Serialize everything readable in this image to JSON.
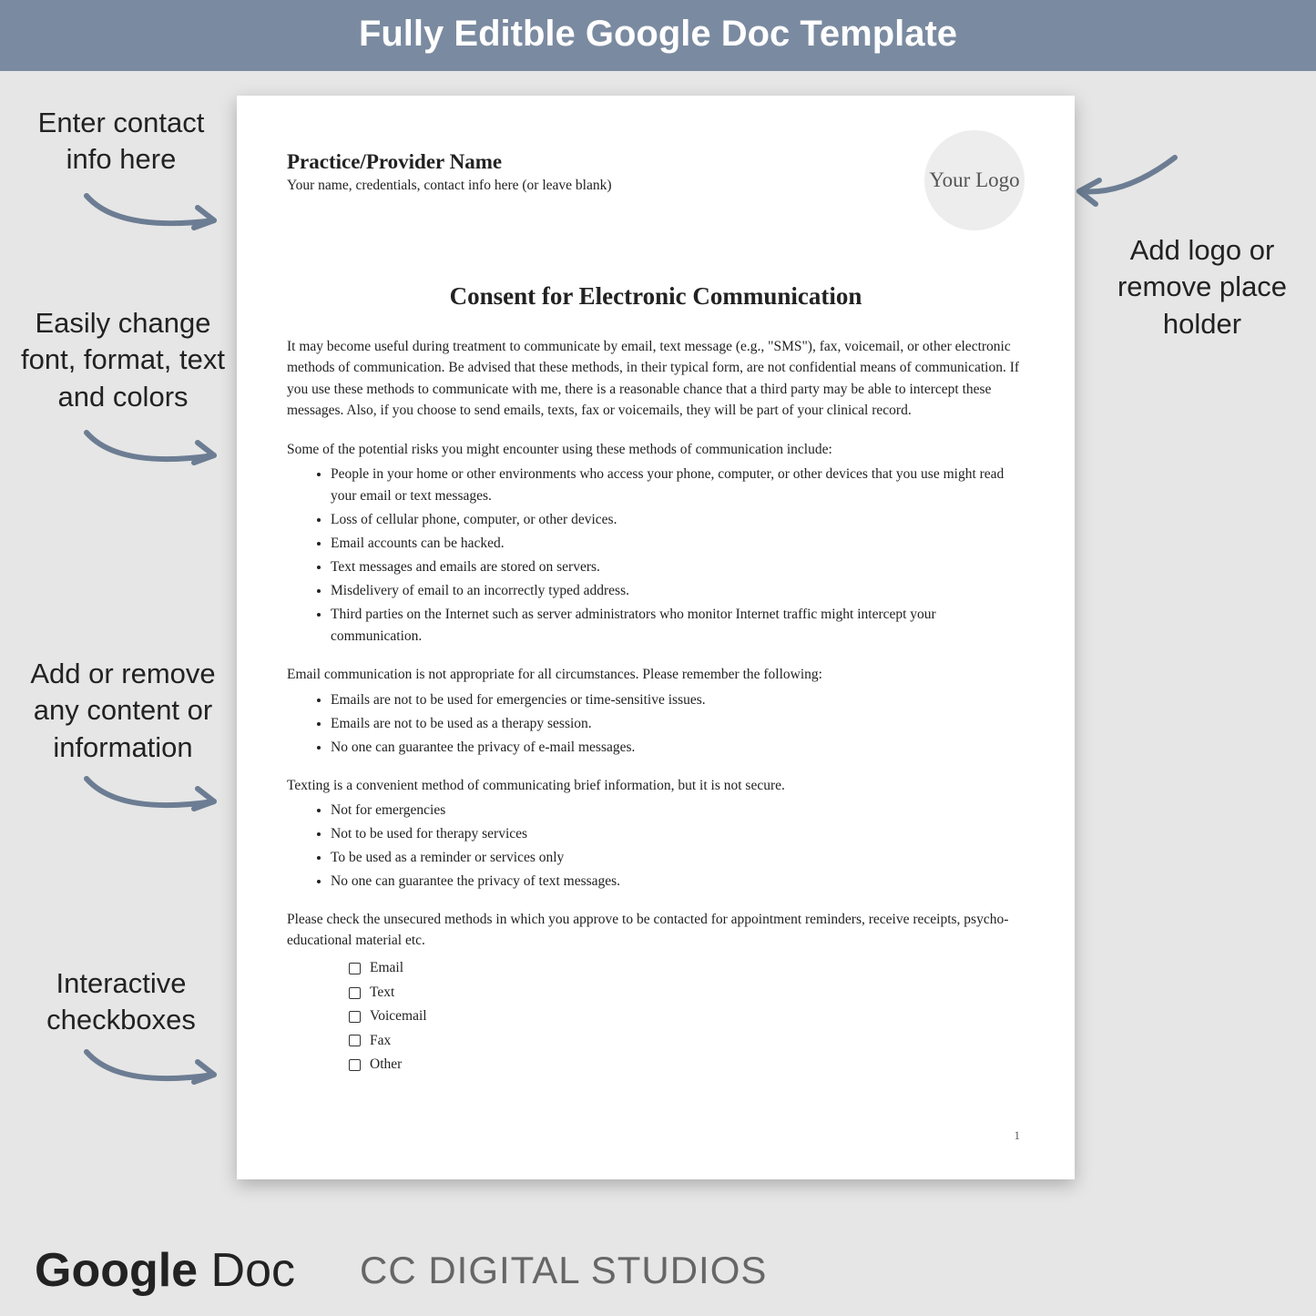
{
  "header": {
    "title": "Fully Editble Google Doc Template"
  },
  "callouts": {
    "contact": "Enter contact info here",
    "font": "Easily change font, format, text and colors",
    "content": "Add or remove any content or information",
    "checkboxes": "Interactive checkboxes",
    "logo": "Add logo or remove place holder"
  },
  "doc": {
    "practice_name": "Practice/Provider Name",
    "practice_sub": "Your name, credentials, contact info here (or leave blank)",
    "logo_text": "Your Logo",
    "title": "Consent for Electronic Communication",
    "para1": "It may become useful during treatment to communicate by email, text message (e.g., \"SMS\"), fax, voicemail, or other electronic methods of communication. Be advised that these methods, in their typical form, are not confidential means of communication. If you use these methods to communicate with me, there is a reasonable chance that a third party may be able to intercept these messages.  Also, if you choose to send emails, texts, fax or voicemails, they will be part of your clinical record.",
    "risks_intro": "Some of the potential risks you might encounter using these methods of communication include:",
    "risks": [
      "People in your home or other environments who access your phone, computer, or other devices that you use might read your email or text messages.",
      "Loss of cellular phone, computer, or other devices.",
      "Email accounts can be hacked.",
      "Text messages and emails are stored on servers.",
      "Misdelivery of email to an incorrectly typed address.",
      "Third parties on the Internet such as server administrators who monitor Internet traffic might intercept your communication."
    ],
    "email_intro": "Email communication is not appropriate for all circumstances.  Please remember the following:",
    "email_list": [
      "Emails are not to be used for emergencies or time-sensitive issues.",
      "Emails are not to be used as a therapy session.",
      "No one can guarantee the privacy of e-mail messages."
    ],
    "text_intro": "Texting is a convenient method of communicating brief information, but it is not secure.",
    "text_list": [
      "Not for emergencies",
      "Not to be used for therapy services",
      "To be used as a reminder or services only",
      "No one can guarantee the privacy of text messages."
    ],
    "check_intro": "Please check the unsecured methods in which you approve to be contacted for appointment reminders, receive receipts, psycho-educational material etc.",
    "checks": [
      "Email",
      "Text",
      "Voicemail",
      "Fax",
      "Other"
    ],
    "page_num": "1"
  },
  "footer": {
    "brand_bold": "Google",
    "brand_light": " Doc",
    "studio": "CC DIGITAL STUDIOS"
  }
}
